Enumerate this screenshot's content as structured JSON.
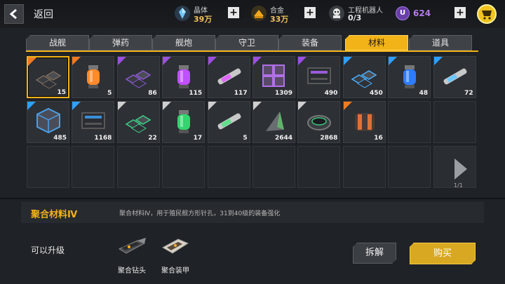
{
  "header": {
    "back_label": "返回",
    "resources": [
      {
        "name": "晶体",
        "value": "39万",
        "icon": "crystal-icon"
      },
      {
        "name": "合金",
        "value": "33万",
        "icon": "alloy-icon"
      },
      {
        "name": "工程机器人",
        "value": "0/3",
        "icon": "robot-icon"
      }
    ],
    "premium": {
      "badge": "U",
      "value": "624"
    },
    "cart_icon": "cart-icon"
  },
  "tabs": [
    {
      "label": "战舰",
      "active": false
    },
    {
      "label": "弹药",
      "active": false
    },
    {
      "label": "舰炮",
      "active": false
    },
    {
      "label": "守卫",
      "active": false
    },
    {
      "label": "装备",
      "active": false
    },
    {
      "label": "材料",
      "active": true
    },
    {
      "label": "道具",
      "active": false
    }
  ],
  "rarity_colors": {
    "orange": "#f07a22",
    "purple": "#9b4fe0",
    "blue": "#2ea0ff",
    "white": "#cfcfcf"
  },
  "items": [
    {
      "qty": "15",
      "rarity": "orange",
      "art": "plates",
      "color": "#7a6a5a",
      "selected": true
    },
    {
      "qty": "5",
      "rarity": "orange",
      "art": "capsule",
      "color": "#ff8a2a"
    },
    {
      "qty": "86",
      "rarity": "purple",
      "art": "plates",
      "color": "#8a5ad0"
    },
    {
      "qty": "115",
      "rarity": "purple",
      "art": "capsule",
      "color": "#c04fff"
    },
    {
      "qty": "117",
      "rarity": "purple",
      "art": "tube",
      "color": "#e066ff"
    },
    {
      "qty": "1309",
      "rarity": "purple",
      "art": "blocks",
      "color": "#b070e8"
    },
    {
      "qty": "490",
      "rarity": "purple",
      "art": "machine",
      "color": "#9a5cd8"
    },
    {
      "qty": "450",
      "rarity": "blue",
      "art": "plates",
      "color": "#4ab0ff"
    },
    {
      "qty": "48",
      "rarity": "blue",
      "art": "capsule",
      "color": "#2e7dff"
    },
    {
      "qty": "72",
      "rarity": "blue",
      "art": "tube",
      "color": "#6cc8ff"
    },
    {
      "qty": "485",
      "rarity": "blue",
      "art": "cube",
      "color": "#4a9fe8"
    },
    {
      "qty": "1168",
      "rarity": "blue",
      "art": "machine",
      "color": "#3a8fd8"
    },
    {
      "qty": "22",
      "rarity": "white",
      "art": "plates",
      "color": "#3fd08a"
    },
    {
      "qty": "17",
      "rarity": "white",
      "art": "capsule",
      "color": "#33d56e"
    },
    {
      "qty": "5",
      "rarity": "white",
      "art": "tube",
      "color": "#5fe08a"
    },
    {
      "qty": "2644",
      "rarity": "white",
      "art": "pyramid",
      "color": "#5fd06a"
    },
    {
      "qty": "2868",
      "rarity": "white",
      "art": "ring",
      "color": "#3fc07a"
    },
    {
      "qty": "16",
      "rarity": "orange",
      "art": "drum",
      "color": "#e0703a"
    }
  ],
  "pager": {
    "text": "1/1"
  },
  "detail": {
    "name": "聚合材料Ⅳ",
    "description": "聚合材料Ⅳ，用于殖民舰方形针孔，31到40级的装备强化"
  },
  "upgrade": {
    "label": "可以升级",
    "items": [
      {
        "label": "聚合钻头",
        "icon": "drill-icon"
      },
      {
        "label": "聚合装甲",
        "icon": "armor-icon"
      }
    ]
  },
  "actions": {
    "dismantle": "拆解",
    "buy": "购买"
  }
}
